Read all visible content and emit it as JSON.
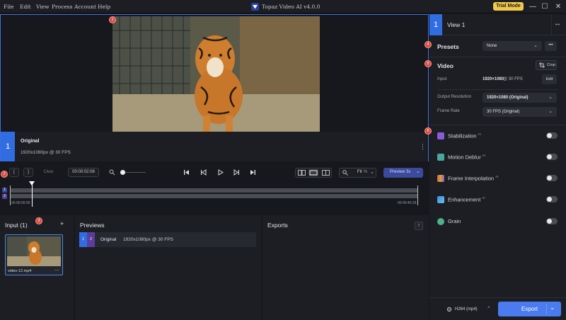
{
  "menu": [
    "File",
    "Edit",
    "View",
    "Process",
    "Account",
    "Help"
  ],
  "app_title": "Topaz Video AI  v4.0.0",
  "trial_label": "Trial Mode",
  "window_controls": {
    "minimize": "—",
    "maximize": "☐",
    "close": "✕"
  },
  "viewer": {
    "view_number": "1",
    "label": "Original",
    "details": "1920x1080px @ 30 FPS",
    "more": "⋮"
  },
  "transport": {
    "in_mark": "[",
    "out_mark": "]",
    "clear_label": "Clear",
    "timecode": "00:00:02:08",
    "zoom_icon": "magnifier-icon",
    "fit_label": "Fit",
    "fit_unit": "%",
    "preview_label": "Preview 3s"
  },
  "timeline": {
    "start_time": "00:00:00:00",
    "end_time": "00:00:40:29",
    "track_labels": [
      "1",
      "2"
    ]
  },
  "markers": [
    "1",
    "2",
    "3",
    "4",
    "5",
    "6"
  ],
  "input_panel": {
    "title": "Input (1)",
    "add": "+",
    "file_name": "video-12.mp4",
    "file_more": "⋯"
  },
  "previews_panel": {
    "title": "Previews",
    "row_num_1": "1",
    "row_num_2": "2",
    "row_label": "Original",
    "row_details": "1920x1080px @ 30 FPS"
  },
  "exports_panel": {
    "title": "Exports",
    "export_icon": "↑"
  },
  "right_panel": {
    "view_number": "1",
    "view_title": "View 1",
    "swap_icon": "↔",
    "presets": {
      "title": "Presets",
      "value": "None",
      "more": "•••"
    },
    "video": {
      "title": "Video",
      "crop_label": "Crop",
      "input_label": "Input",
      "input_value": "1920×1080",
      "input_at": " @ 30 FPS",
      "edit_label": "Edit",
      "out_res_label": "Output Resolution",
      "out_res_value": "1920×1080 (Original)",
      "frame_rate_label": "Frame Rate",
      "frame_rate_value": "30 FPS (Original)"
    },
    "features": [
      {
        "label": "Stabilization",
        "ai": "AI",
        "color": "#8a5bd6"
      },
      {
        "label": "Motion Deblur",
        "ai": "AI",
        "color": "#4aa7a0"
      },
      {
        "label": "Frame Interpolation",
        "ai": "AI",
        "color": "#d66a3c"
      },
      {
        "label": "Enhancement",
        "ai": "AI",
        "color": "#3a8ee0"
      },
      {
        "label": "Grain",
        "ai": "",
        "color": "#4fb28a"
      }
    ],
    "encoder_label": "H264 (mp4)",
    "export_label": "Export"
  },
  "colors": {
    "accent": "#3f6fe0",
    "export": "#4a7cf0",
    "trial": "#f0c94a",
    "marker": "#e2473b"
  }
}
